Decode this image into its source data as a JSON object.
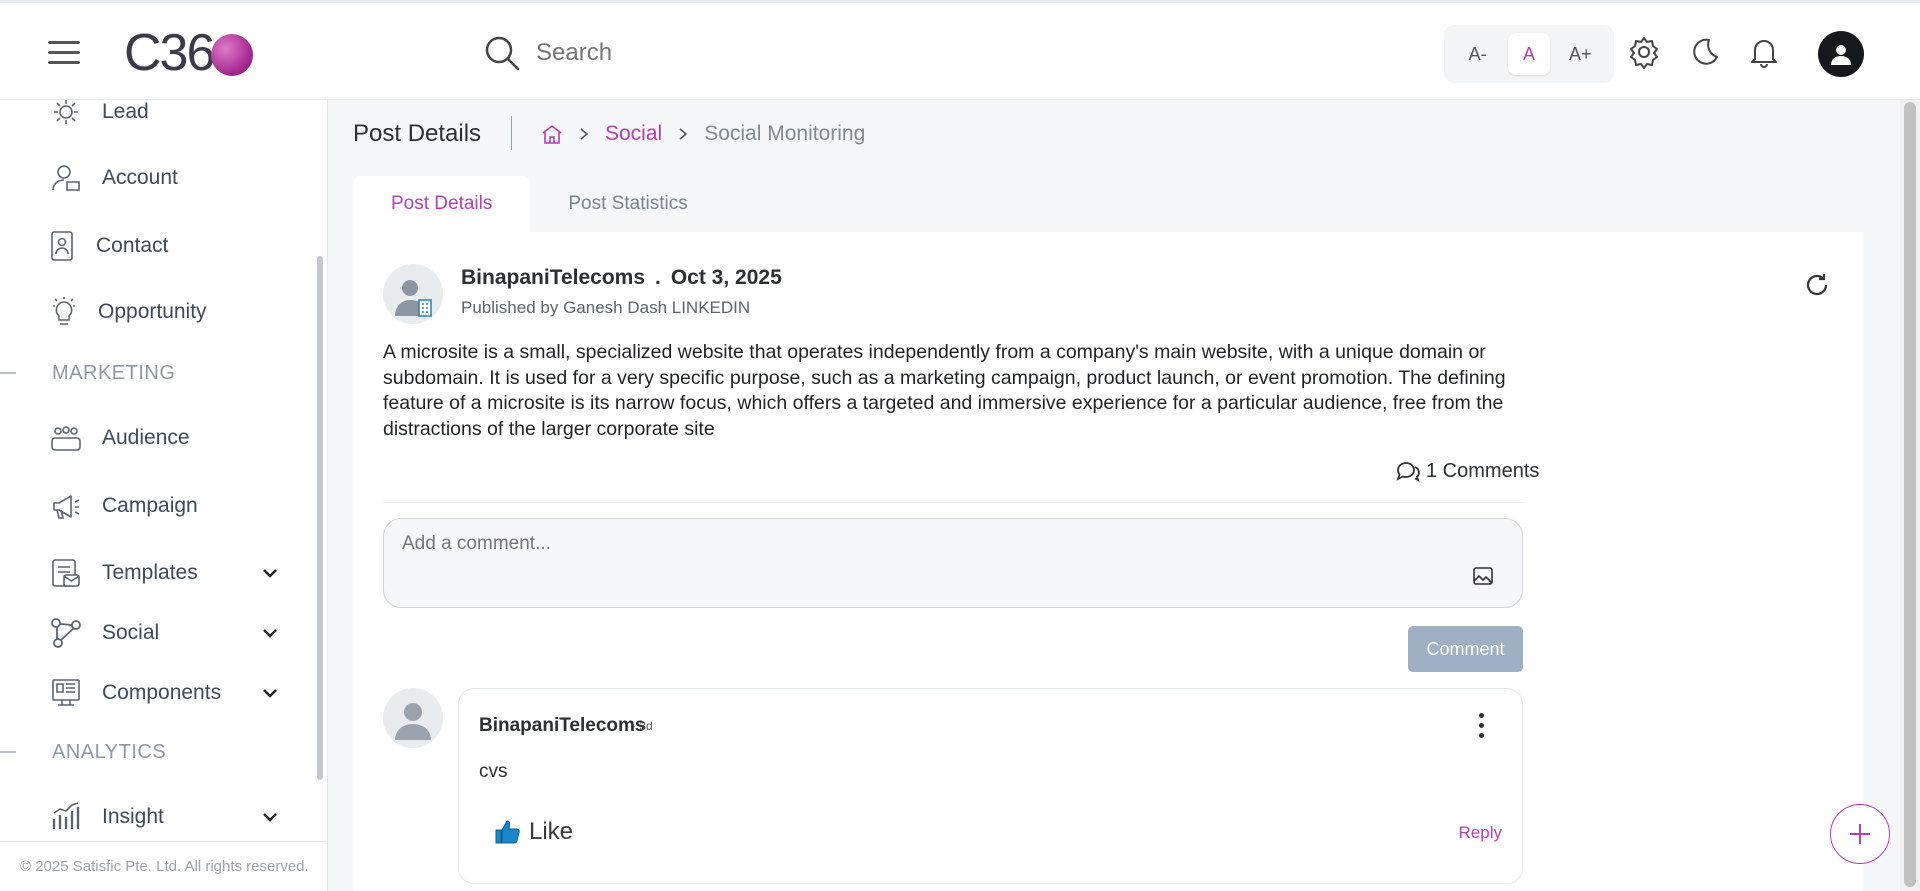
{
  "header": {
    "logo_text": "C36",
    "search_placeholder": "Search",
    "font_decrease": "A-",
    "font_normal": "A",
    "font_increase": "A+"
  },
  "sidebar": {
    "items": [
      {
        "label": "Lead",
        "icon": "lead-icon"
      },
      {
        "label": "Account",
        "icon": "account-icon"
      },
      {
        "label": "Contact",
        "icon": "contact-icon"
      },
      {
        "label": "Opportunity",
        "icon": "lightbulb-icon"
      },
      {
        "label": "Audience",
        "icon": "audience-icon"
      },
      {
        "label": "Campaign",
        "icon": "megaphone-icon"
      },
      {
        "label": "Templates",
        "icon": "templates-icon"
      },
      {
        "label": "Social",
        "icon": "social-icon"
      },
      {
        "label": "Components",
        "icon": "components-icon"
      },
      {
        "label": "Insight",
        "icon": "chart-icon"
      }
    ],
    "sections": {
      "marketing": "MARKETING",
      "analytics": "ANALYTICS"
    },
    "copyright": "© 2025 Satisfic Pte. Ltd. All rights reserved."
  },
  "main": {
    "page_title": "Post Details",
    "breadcrumb": {
      "social": "Social",
      "current": "Social Monitoring"
    },
    "tabs": [
      "Post Details",
      "Post Statistics"
    ],
    "post": {
      "author": "BinapaniTelecoms",
      "separator": ".",
      "date": "Oct 3, 2025",
      "published_by": "Published by Ganesh Dash LINKEDIN",
      "body": "A microsite is a small, specialized website that operates independently from a company's main website, with a unique domain or subdomain. It is used for a very specific purpose, such as a marketing campaign, product launch, or event promotion. The defining feature of a microsite is its narrow focus, which offers a targeted and immersive experience for a particular audience, free from the distractions of the larger corporate site",
      "comments_count": "1 Comments"
    },
    "comment_input_placeholder": "Add a comment...",
    "comment_button": "Comment",
    "comment": {
      "author": "BinapaniTelecoms",
      "time": "· 3d",
      "text": "cvs",
      "like_label": "Like",
      "reply_label": "Reply"
    }
  },
  "colors": {
    "accent": "#b33fb0",
    "button_disabled": "#9fb0c4"
  }
}
